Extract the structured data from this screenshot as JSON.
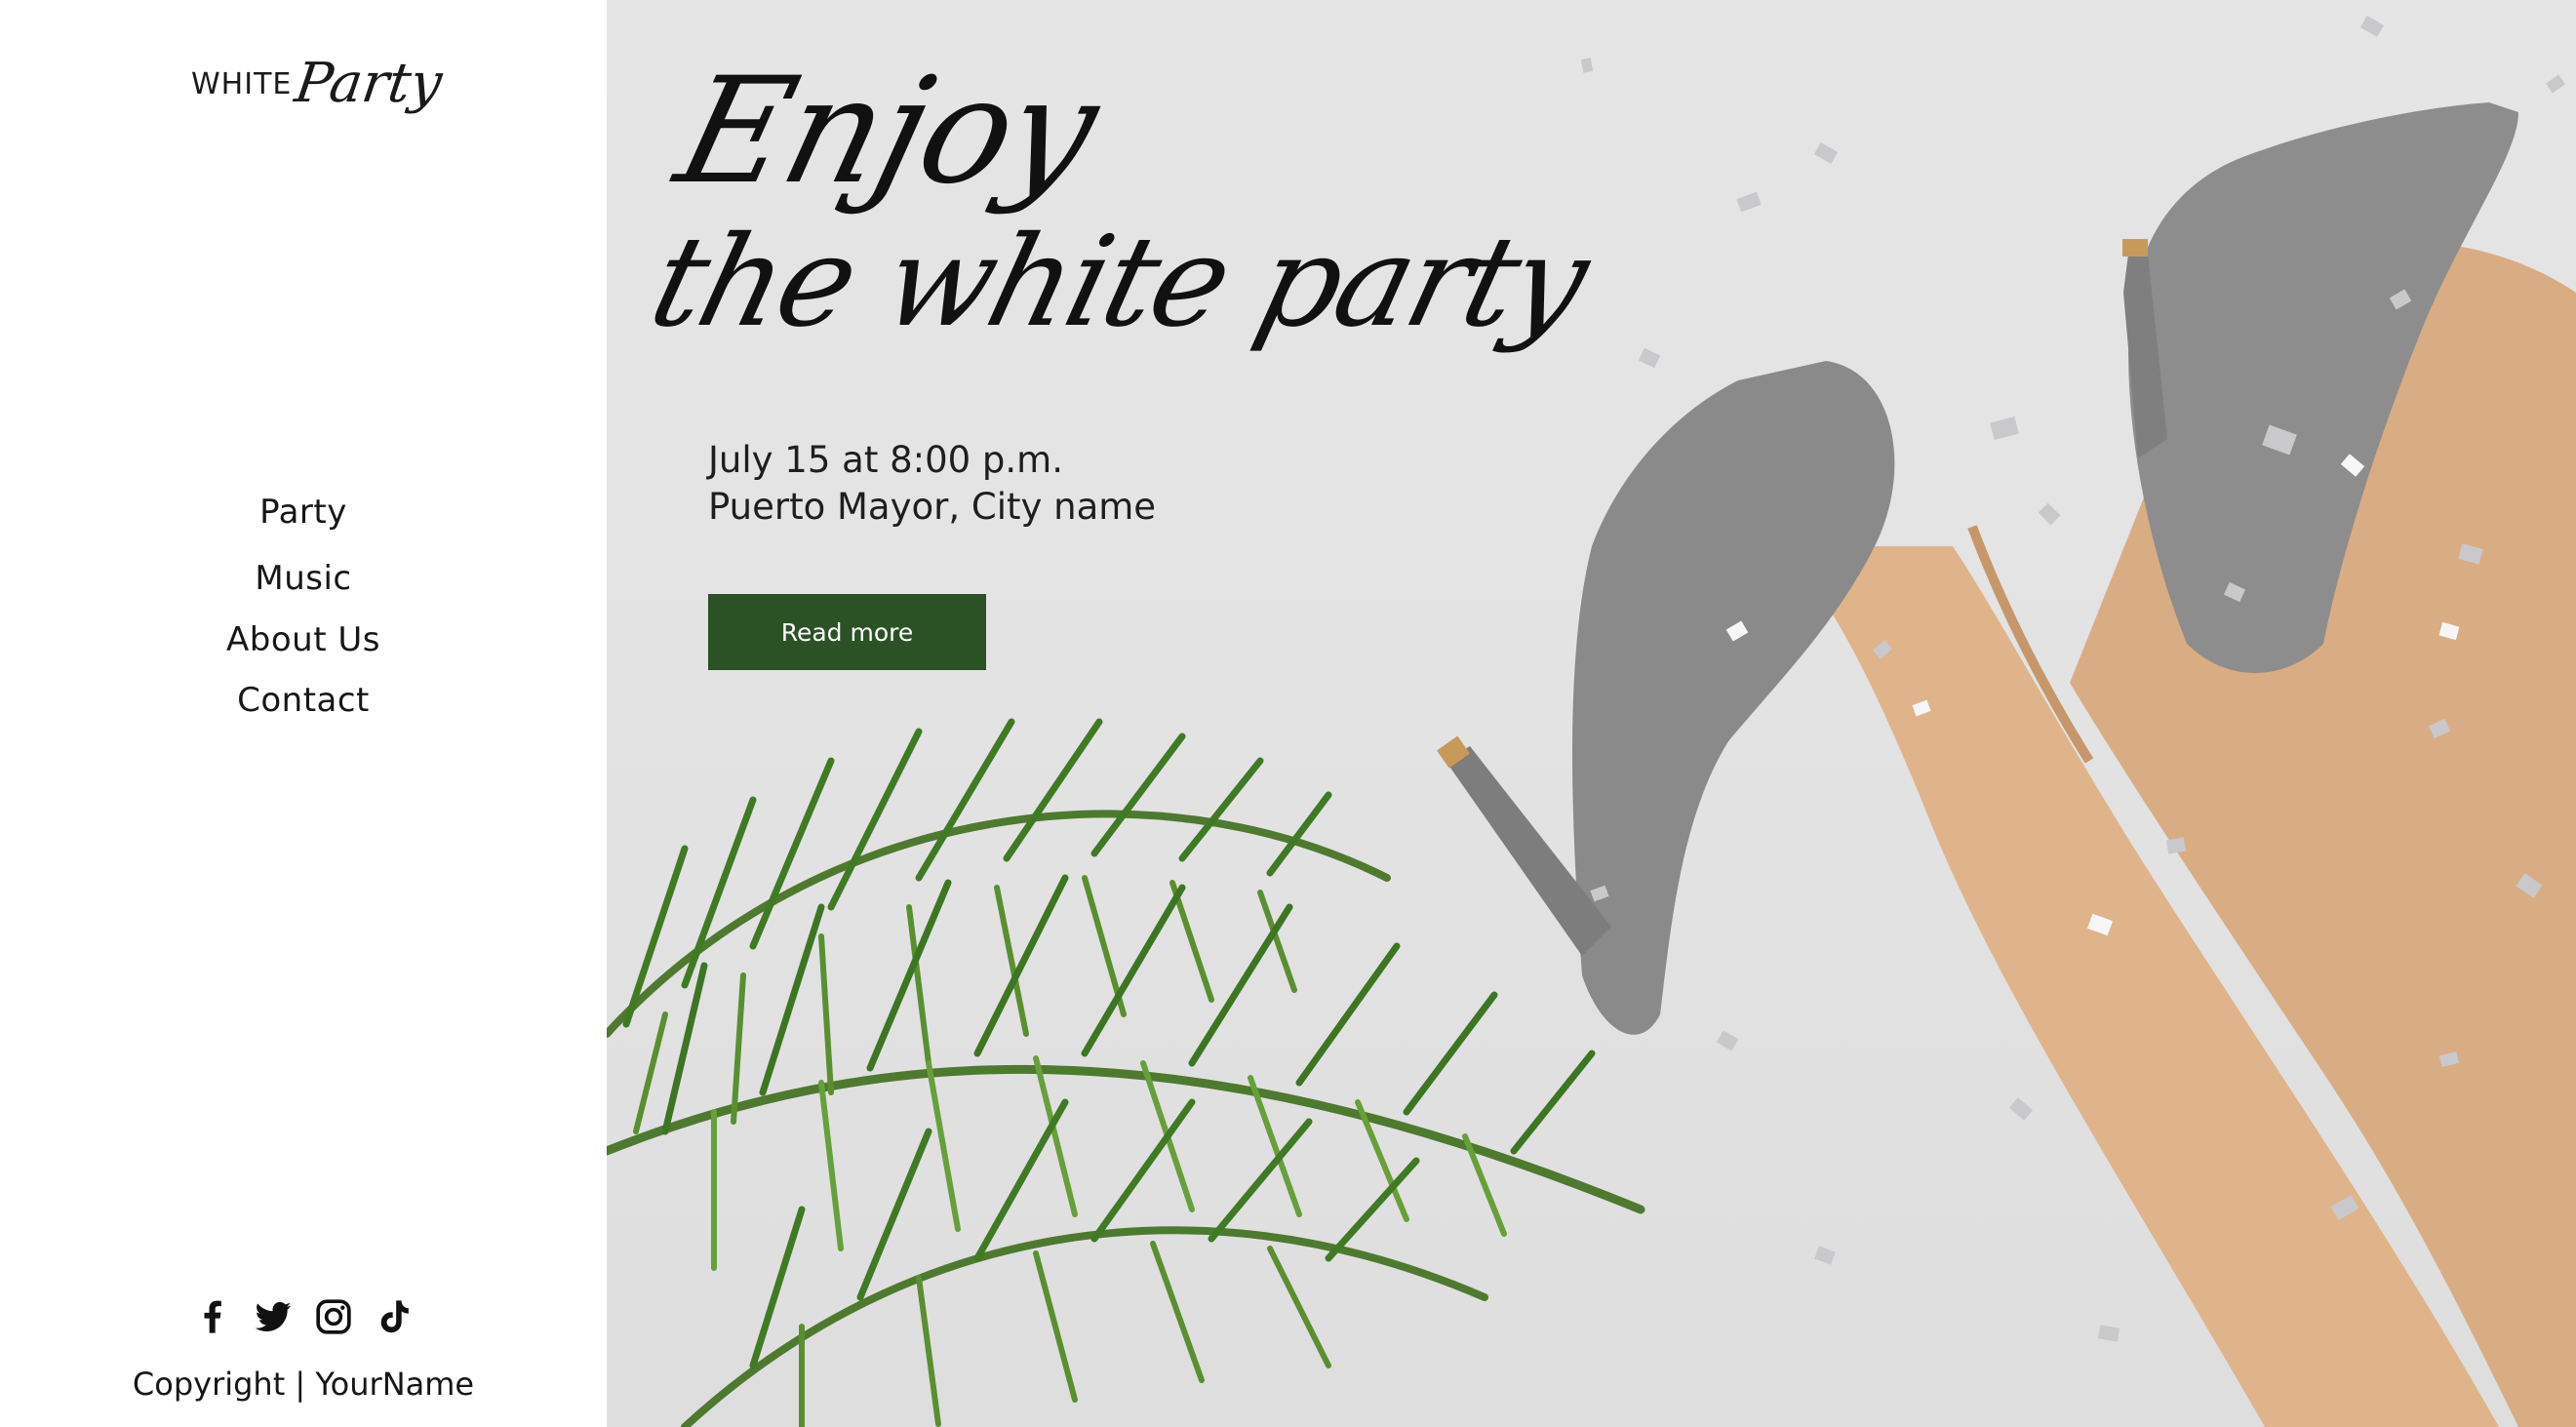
{
  "brand": {
    "logo_word_1": "WHITE",
    "logo_word_2": "Party"
  },
  "nav": {
    "items": [
      "Party",
      "Music",
      "About Us",
      "Contact"
    ]
  },
  "social": {
    "icons": [
      "facebook-icon",
      "twitter-icon",
      "instagram-icon",
      "tiktok-icon"
    ]
  },
  "footer": {
    "copyright": "Copyright | YourName"
  },
  "hero": {
    "headline_line1": "Enjoy",
    "headline_line2": "the white party",
    "date_line": "July 15 at 8:00 p.m.",
    "location_line": "Puerto Mayor, City name",
    "cta_label": "Read more"
  },
  "colors": {
    "cta_background": "#2a5224",
    "page_background": "#ffffff",
    "hero_background": "#e4e4e4",
    "text": "#161616"
  }
}
